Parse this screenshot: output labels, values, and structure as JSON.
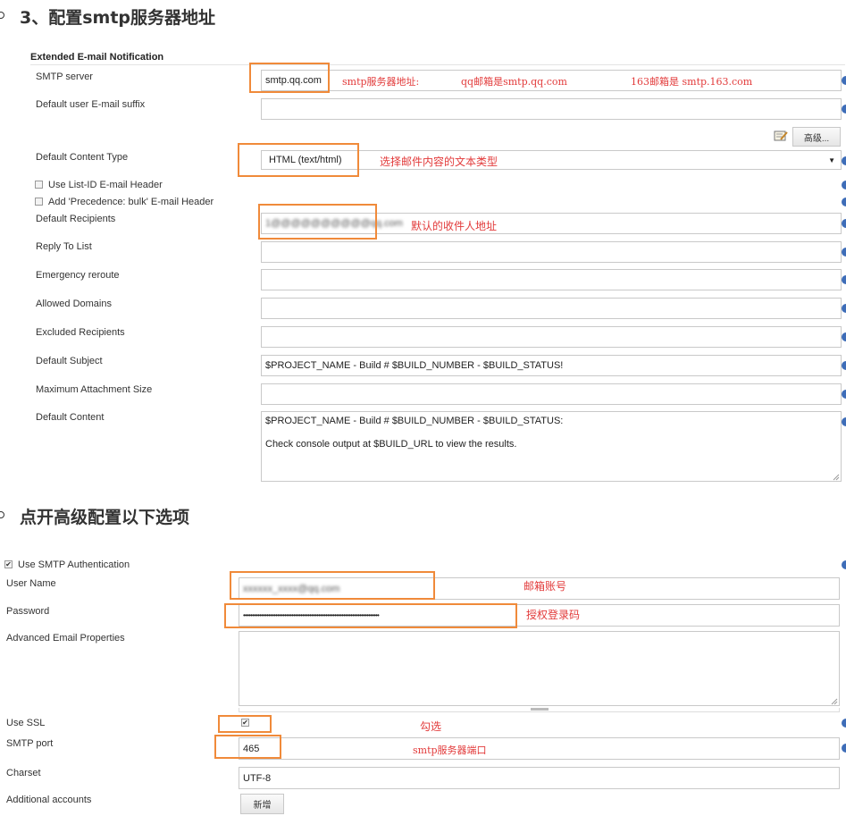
{
  "section1": {
    "heading": "3、配置smtp服务器地址",
    "panel_title": "Extended E-mail Notification",
    "smtp_server": {
      "label": "SMTP server",
      "value": "smtp.qq.com"
    },
    "anno_smtp_server": "smtp服务器地址:",
    "anno_qq": "qq邮箱是smtp.qq.com",
    "anno_163": "163邮箱是 smtp.163.com",
    "default_suffix": {
      "label": "Default user E-mail suffix",
      "value": ""
    },
    "advanced_button": "高级...",
    "content_type": {
      "label": "Default Content Type",
      "value": "HTML (text/html)"
    },
    "anno_content_type": "选择邮件内容的文本类型",
    "use_list_id": "Use List-ID E-mail Header",
    "add_precedence": "Add 'Precedence: bulk' E-mail Header",
    "default_recipients": {
      "label": "Default Recipients",
      "value": "1@@@@@@@@@@qq.com"
    },
    "anno_recipients": "默认的收件人地址",
    "reply_to": {
      "label": "Reply To List",
      "value": ""
    },
    "emergency": {
      "label": "Emergency reroute",
      "value": ""
    },
    "allowed": {
      "label": "Allowed Domains",
      "value": ""
    },
    "excluded": {
      "label": "Excluded Recipients",
      "value": ""
    },
    "subject": {
      "label": "Default Subject",
      "value": "$PROJECT_NAME - Build # $BUILD_NUMBER - $BUILD_STATUS!"
    },
    "max_attach": {
      "label": "Maximum Attachment Size",
      "value": ""
    },
    "content": {
      "label": "Default Content",
      "line1": "$PROJECT_NAME - Build # $BUILD_NUMBER - $BUILD_STATUS:",
      "line2": "Check console output at $BUILD_URL to view the results."
    }
  },
  "section2": {
    "heading": "点开高级配置以下选项",
    "use_auth": "Use SMTP Authentication",
    "username": {
      "label": "User Name",
      "value": "xxxxxx_xxxx@qq.com"
    },
    "anno_username": "邮箱账号",
    "password": {
      "label": "Password",
      "value": "••••••••••••••••••••••••••••••••••••••••••••••••••••••••••••••••••••••••••••"
    },
    "anno_password": "授权登录码",
    "advanced_props": {
      "label": "Advanced Email Properties",
      "value": ""
    },
    "use_ssl": {
      "label": "Use SSL",
      "checked": true
    },
    "anno_ssl": "勾选",
    "smtp_port": {
      "label": "SMTP port",
      "value": "465"
    },
    "anno_port": "smtp服务器端口",
    "charset": {
      "label": "Charset",
      "value": "UTF-8"
    },
    "additional": {
      "label": "Additional accounts",
      "button": "新增"
    }
  },
  "colors": {
    "annotation_box": "#f08a3a",
    "annotation_text": "#e23a3a",
    "help_icon": "#3e6db8"
  }
}
